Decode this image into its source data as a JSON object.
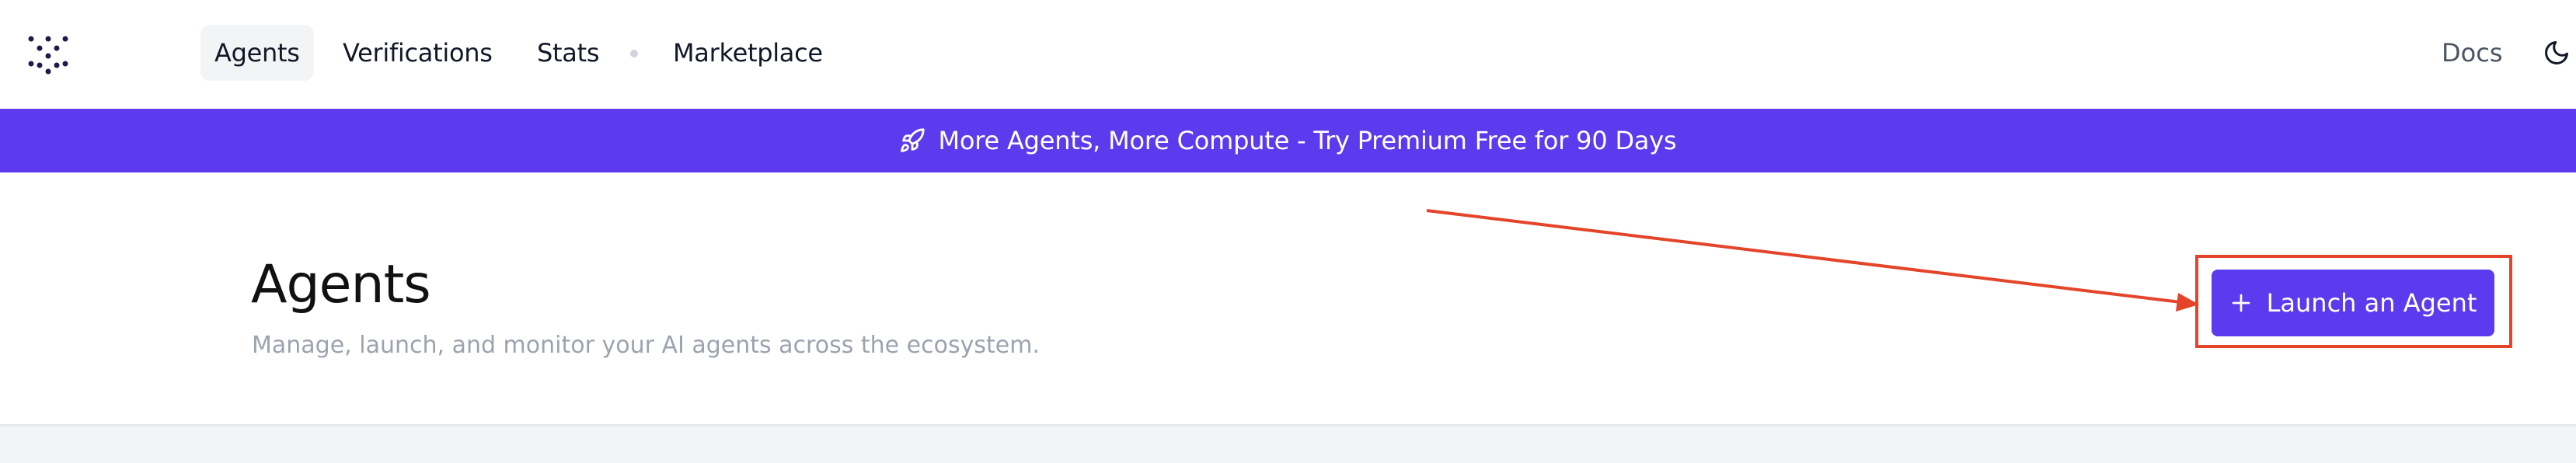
{
  "nav": {
    "items": [
      {
        "label": "Agents",
        "active": true
      },
      {
        "label": "Verifications",
        "active": false
      },
      {
        "label": "Stats",
        "active": false
      },
      {
        "label": "Marketplace",
        "active": false
      }
    ],
    "docs_label": "Docs",
    "logo_icon": "dot-grid-logo-icon",
    "theme_icon": "moon-icon"
  },
  "banner": {
    "text": "More Agents, More Compute - Try Premium Free for 90 Days",
    "icon": "rocket-icon"
  },
  "header": {
    "title": "Agents",
    "subtitle": "Manage, launch, and monitor your AI agents across the ecosystem.",
    "cta_label": "Launch an Agent",
    "cta_icon": "plus-icon"
  },
  "colors": {
    "accent": "#5b3bed",
    "annotation": "#e4442a",
    "muted_text": "#9ca3af"
  }
}
